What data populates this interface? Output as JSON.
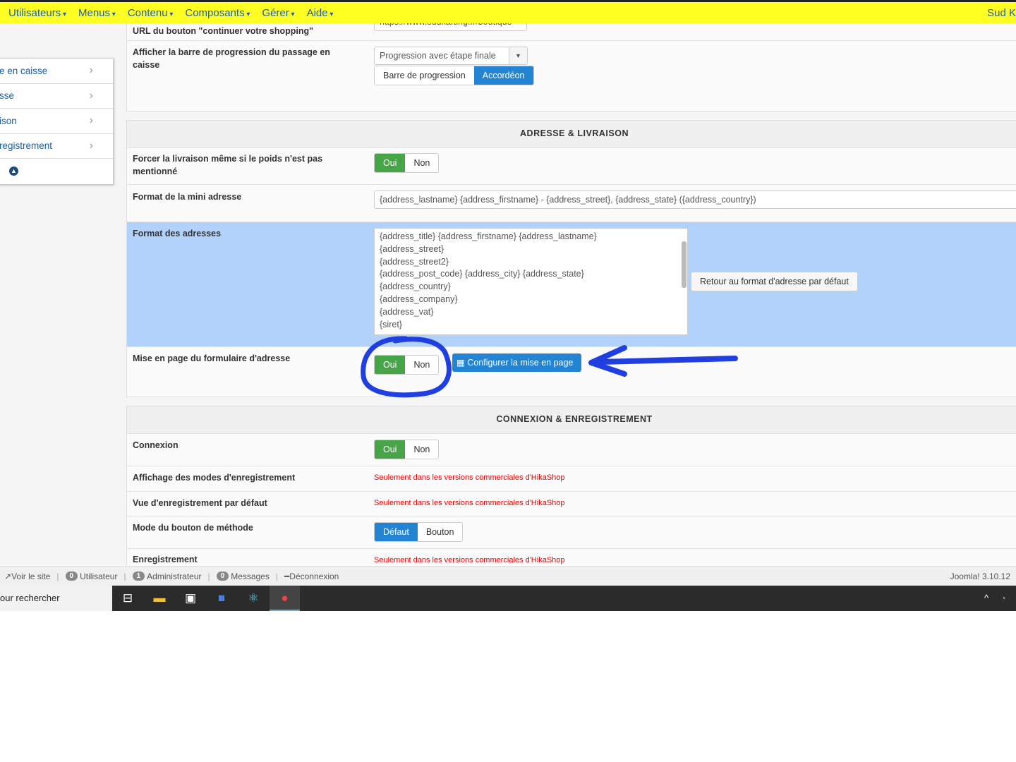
{
  "nav": {
    "items": [
      "Utilisateurs",
      "Menus",
      "Contenu",
      "Composants",
      "Gérer",
      "Aide"
    ],
    "right": "Sud K"
  },
  "sidebar": {
    "items": [
      "e en caisse",
      "sse",
      "ison",
      "registrement"
    ]
  },
  "top_row": {
    "label": "URL du bouton \"continuer votre shopping\"",
    "value": "https://www.sudkarting.fr/boutique"
  },
  "progress": {
    "label": "Afficher la barre de progression du passage en caisse",
    "select": "Progression avec étape finale",
    "options": [
      "Barre de progression",
      "Accordéon"
    ],
    "active": "Accordéon"
  },
  "address": {
    "heading": "ADRESSE & LIVRAISON",
    "force": {
      "label": "Forcer la livraison même si le poids n'est pas mentionné",
      "yes": "Oui",
      "no": "Non",
      "active": "Oui"
    },
    "mini": {
      "label": "Format de la mini adresse",
      "value": "{address_lastname} {address_firstname} - {address_street}, {address_state} ({address_country})"
    },
    "format": {
      "label": "Format des adresses",
      "lines": [
        "{address_title} {address_firstname} {address_lastname}",
        "{address_street}",
        "{address_street2}",
        "{address_post_code} {address_city} {address_state}",
        "{address_country}",
        "{address_company}",
        "{address_vat}",
        "{siret}"
      ],
      "reset": "Retour au format d'adresse par défaut"
    },
    "layout": {
      "label": "Mise en page du formulaire d'adresse",
      "yes": "Oui",
      "no": "Non",
      "active": "Oui",
      "configure": "Configurer la mise en page"
    }
  },
  "connexion": {
    "heading": "CONNEXION & ENREGISTREMENT",
    "login": {
      "label": "Connexion",
      "yes": "Oui",
      "no": "Non",
      "active": "Oui"
    },
    "modes": {
      "label": "Affichage des modes d'enregistrement",
      "value": "Seulement dans les versions commerciales d'HikaShop"
    },
    "view": {
      "label": "Vue d'enregistrement par défaut",
      "value": "Seulement dans les versions commerciales d'HikaShop"
    },
    "method": {
      "label": "Mode du bouton de méthode",
      "options": [
        "Défaut",
        "Bouton"
      ],
      "active": "Défaut"
    },
    "register": {
      "label": "Enregistrement",
      "value": "Seulement dans les versions commerciales d'HikaShop"
    }
  },
  "status": {
    "site": "Voir le site",
    "users_count": "0",
    "users": "Utilisateur",
    "admin_count": "1",
    "admin": "Administrateur",
    "msg_count": "0",
    "msgs": "Messages",
    "logout": "Déconnexion",
    "version": "Joomla! 3.10.12"
  },
  "taskbar": {
    "search": "our rechercher"
  },
  "colors": {
    "nav": "#ffff22",
    "green": "#46a546",
    "blue": "#2384d3",
    "annotation": "#1f3fe0"
  }
}
